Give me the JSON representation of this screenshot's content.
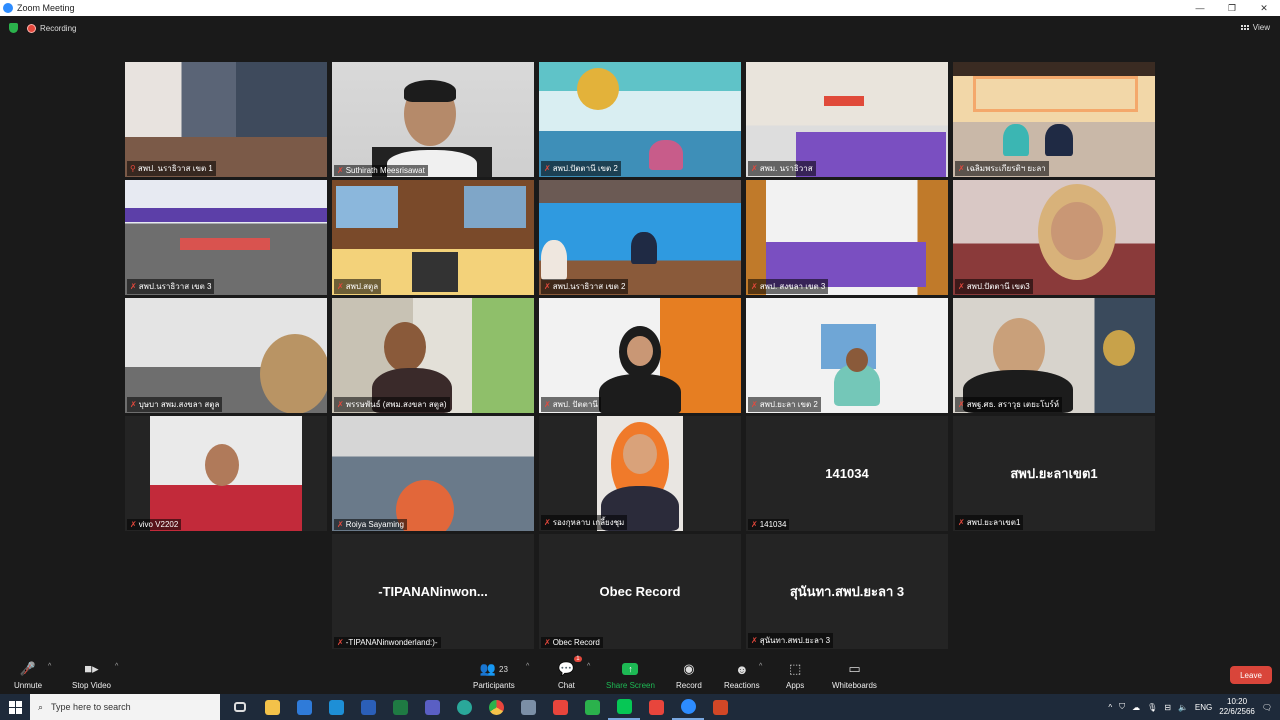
{
  "window": {
    "title": "Zoom Meeting",
    "controls": [
      "—",
      "❐",
      "✕"
    ]
  },
  "status": {
    "recording_label": "Recording",
    "view_label": "View"
  },
  "tiles": [
    {
      "label": "สพป. นราธิวาส เขต 1"
    },
    {
      "label": "Suthirath Meesrisawat"
    },
    {
      "label": "สพป.ปัตตานี เขต 2"
    },
    {
      "label": "สพม. นราธิวาส"
    },
    {
      "label": "เฉลิมพระเกียรติฯ ยะลา"
    },
    {
      "label": "สพป.นราธิวาส เขต 3"
    },
    {
      "label": "สพป.สตูล"
    },
    {
      "label": "สพป.นราธิวาส เขต 2"
    },
    {
      "label": "สพป. สงขลา เขต 3"
    },
    {
      "label": "สพป.ปัตตานี เขต3"
    },
    {
      "label": "บุษบา สพม.สงขลา สตูล"
    },
    {
      "label": "พรรษพันธ์ (สพม.สงขลา สตูล)"
    },
    {
      "label": "สพป. ปัตตานี"
    },
    {
      "label": "สพป.ยะลา เขต 2"
    },
    {
      "label": "สพฐ.ศธ. สราวุธ เตยะโบร์ห์"
    },
    {
      "label": "vivo V2202"
    },
    {
      "label": "Roiya Sayaming"
    },
    {
      "label": "รองกุหลาบ เกลี้ยงชุม"
    },
    {
      "label": "141034",
      "display": "141034"
    },
    {
      "label": "สพป.ยะลาเขต1",
      "display": "สพป.ยะลาเขต1"
    },
    {
      "label": "-TIPANANinwonderland:)-",
      "display": "-TIPANANinwon..."
    },
    {
      "label": "Obec Record",
      "display": "Obec Record"
    },
    {
      "label": "สุนันทา.สพป.ยะลา 3",
      "display": "สุนันทา.สพป.ยะลา 3"
    }
  ],
  "toolbar": {
    "unmute": "Unmute",
    "stop_video": "Stop Video",
    "participants": "Participants",
    "participants_count": "23",
    "chat": "Chat",
    "chat_badge": "1",
    "share_screen": "Share Screen",
    "record": "Record",
    "reactions": "Reactions",
    "apps": "Apps",
    "whiteboards": "Whiteboards",
    "leave": "Leave"
  },
  "taskbar": {
    "search_placeholder": "Type here to search",
    "language": "ENG",
    "time": "10:20",
    "date": "22/6/2566"
  },
  "colors": {
    "accent_green": "#1db954",
    "leave_red": "#d9453a",
    "active_speaker": "#d6e36a"
  }
}
